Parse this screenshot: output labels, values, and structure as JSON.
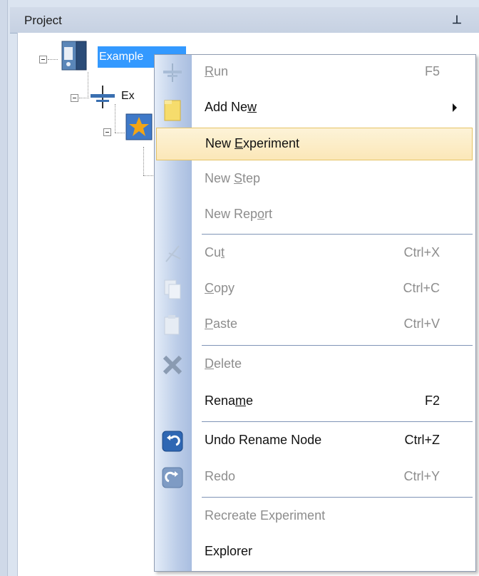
{
  "panel": {
    "title": "Project"
  },
  "tree": {
    "root_label": "Example",
    "child_label": "Ex"
  },
  "context_menu": {
    "items": [
      {
        "pre": "",
        "key": "R",
        "post": "un",
        "shortcut": "F5",
        "enabled": false,
        "icon": "run-icon"
      },
      {
        "pre": "Add Ne",
        "key": "w",
        "post": "",
        "shortcut": "",
        "enabled": true,
        "icon": "folder-icon",
        "submenu": true
      },
      {
        "pre": "New ",
        "key": "E",
        "post": "xperiment",
        "shortcut": "",
        "enabled": true,
        "highlighted": true
      },
      {
        "pre": "New ",
        "key": "S",
        "post": "tep",
        "shortcut": "",
        "enabled": false
      },
      {
        "pre": "New Rep",
        "key": "o",
        "post": "rt",
        "shortcut": "",
        "enabled": false
      },
      {
        "pre": "Cu",
        "key": "t",
        "post": "",
        "shortcut": "Ctrl+X",
        "enabled": false,
        "icon": "cut-icon"
      },
      {
        "pre": "",
        "key": "C",
        "post": "opy",
        "shortcut": "Ctrl+C",
        "enabled": false,
        "icon": "copy-icon"
      },
      {
        "pre": "",
        "key": "P",
        "post": "aste",
        "shortcut": "Ctrl+V",
        "enabled": false,
        "icon": "paste-icon"
      },
      {
        "pre": "",
        "key": "D",
        "post": "elete",
        "shortcut": "",
        "enabled": false,
        "icon": "delete-icon"
      },
      {
        "pre": "Rena",
        "key": "m",
        "post": "e",
        "shortcut": "F2",
        "enabled": true
      },
      {
        "pre": "Undo Rename Node",
        "key": "",
        "post": "",
        "shortcut": "Ctrl+Z",
        "enabled": true,
        "icon": "undo-icon"
      },
      {
        "pre": "Redo",
        "key": "",
        "post": "",
        "shortcut": "Ctrl+Y",
        "enabled": false,
        "icon": "redo-icon"
      },
      {
        "pre": "Recreate Experiment",
        "key": "",
        "post": "",
        "shortcut": "",
        "enabled": false
      },
      {
        "pre": "Explorer",
        "key": "",
        "post": "",
        "shortcut": "",
        "enabled": true
      }
    ]
  },
  "colors": {
    "selection": "#3399ff",
    "highlight_border": "#e5c365",
    "disabled_text": "#8d8d8d"
  }
}
